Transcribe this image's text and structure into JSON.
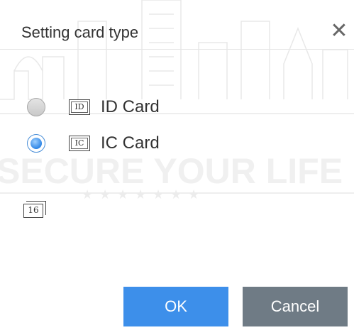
{
  "dialog": {
    "title": "Setting card type",
    "close_glyph": "✕",
    "close_icon": "close-icon"
  },
  "options": [
    {
      "label": "ID Card",
      "icon_text": "ID",
      "icon": "id-card-icon",
      "checked": false
    },
    {
      "label": "IC Card",
      "icon_text": "IC",
      "icon": "ic-card-icon",
      "checked": true
    }
  ],
  "digits": {
    "icon_text": "16",
    "icon": "card-digits-icon"
  },
  "buttons": {
    "ok_label": "OK",
    "cancel_label": "Cancel"
  },
  "watermark": {
    "text": "SECURE YOUR LIFE"
  },
  "colors": {
    "primary": "#3d8fea",
    "secondary": "#6f7b85",
    "radio_checked": "#2f86e6"
  }
}
